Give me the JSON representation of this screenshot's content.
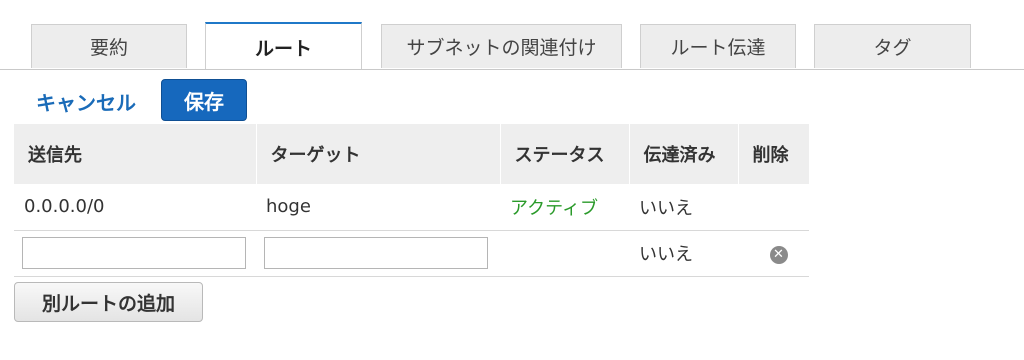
{
  "tabs": [
    {
      "label": "要約"
    },
    {
      "label": "ルート"
    },
    {
      "label": "サブネットの関連付け"
    },
    {
      "label": "ルート伝達"
    },
    {
      "label": "タグ"
    }
  ],
  "actions": {
    "cancel_label": "キャンセル",
    "save_label": "保存"
  },
  "table": {
    "headers": [
      "送信先",
      "ターゲット",
      "ステータス",
      "伝達済み",
      "削除"
    ],
    "rows": [
      {
        "destination": "0.0.0.0/0",
        "target": "hoge",
        "status": "アクティブ",
        "propagated": "いいえ"
      },
      {
        "destination": "",
        "target": "",
        "propagated": "いいえ"
      }
    ]
  },
  "add_route_label": "別ルートの追加",
  "colors": {
    "accent": "#1668bd",
    "status_active": "#2a9a2a"
  },
  "icons": {
    "delete": "remove-circle-icon"
  }
}
